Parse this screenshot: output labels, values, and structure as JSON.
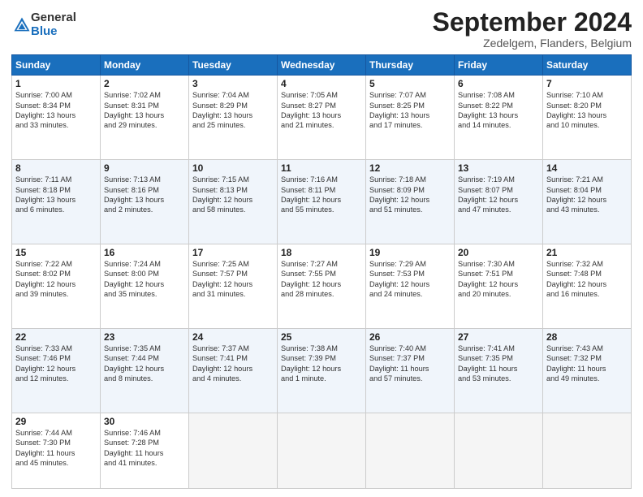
{
  "logo": {
    "general": "General",
    "blue": "Blue"
  },
  "title": "September 2024",
  "subtitle": "Zedelgem, Flanders, Belgium",
  "days": [
    "Sunday",
    "Monday",
    "Tuesday",
    "Wednesday",
    "Thursday",
    "Friday",
    "Saturday"
  ],
  "weeks": [
    [
      {
        "day": "1",
        "text": "Sunrise: 7:00 AM\nSunset: 8:34 PM\nDaylight: 13 hours\nand 33 minutes."
      },
      {
        "day": "2",
        "text": "Sunrise: 7:02 AM\nSunset: 8:31 PM\nDaylight: 13 hours\nand 29 minutes."
      },
      {
        "day": "3",
        "text": "Sunrise: 7:04 AM\nSunset: 8:29 PM\nDaylight: 13 hours\nand 25 minutes."
      },
      {
        "day": "4",
        "text": "Sunrise: 7:05 AM\nSunset: 8:27 PM\nDaylight: 13 hours\nand 21 minutes."
      },
      {
        "day": "5",
        "text": "Sunrise: 7:07 AM\nSunset: 8:25 PM\nDaylight: 13 hours\nand 17 minutes."
      },
      {
        "day": "6",
        "text": "Sunrise: 7:08 AM\nSunset: 8:22 PM\nDaylight: 13 hours\nand 14 minutes."
      },
      {
        "day": "7",
        "text": "Sunrise: 7:10 AM\nSunset: 8:20 PM\nDaylight: 13 hours\nand 10 minutes."
      }
    ],
    [
      {
        "day": "8",
        "text": "Sunrise: 7:11 AM\nSunset: 8:18 PM\nDaylight: 13 hours\nand 6 minutes."
      },
      {
        "day": "9",
        "text": "Sunrise: 7:13 AM\nSunset: 8:16 PM\nDaylight: 13 hours\nand 2 minutes."
      },
      {
        "day": "10",
        "text": "Sunrise: 7:15 AM\nSunset: 8:13 PM\nDaylight: 12 hours\nand 58 minutes."
      },
      {
        "day": "11",
        "text": "Sunrise: 7:16 AM\nSunset: 8:11 PM\nDaylight: 12 hours\nand 55 minutes."
      },
      {
        "day": "12",
        "text": "Sunrise: 7:18 AM\nSunset: 8:09 PM\nDaylight: 12 hours\nand 51 minutes."
      },
      {
        "day": "13",
        "text": "Sunrise: 7:19 AM\nSunset: 8:07 PM\nDaylight: 12 hours\nand 47 minutes."
      },
      {
        "day": "14",
        "text": "Sunrise: 7:21 AM\nSunset: 8:04 PM\nDaylight: 12 hours\nand 43 minutes."
      }
    ],
    [
      {
        "day": "15",
        "text": "Sunrise: 7:22 AM\nSunset: 8:02 PM\nDaylight: 12 hours\nand 39 minutes."
      },
      {
        "day": "16",
        "text": "Sunrise: 7:24 AM\nSunset: 8:00 PM\nDaylight: 12 hours\nand 35 minutes."
      },
      {
        "day": "17",
        "text": "Sunrise: 7:25 AM\nSunset: 7:57 PM\nDaylight: 12 hours\nand 31 minutes."
      },
      {
        "day": "18",
        "text": "Sunrise: 7:27 AM\nSunset: 7:55 PM\nDaylight: 12 hours\nand 28 minutes."
      },
      {
        "day": "19",
        "text": "Sunrise: 7:29 AM\nSunset: 7:53 PM\nDaylight: 12 hours\nand 24 minutes."
      },
      {
        "day": "20",
        "text": "Sunrise: 7:30 AM\nSunset: 7:51 PM\nDaylight: 12 hours\nand 20 minutes."
      },
      {
        "day": "21",
        "text": "Sunrise: 7:32 AM\nSunset: 7:48 PM\nDaylight: 12 hours\nand 16 minutes."
      }
    ],
    [
      {
        "day": "22",
        "text": "Sunrise: 7:33 AM\nSunset: 7:46 PM\nDaylight: 12 hours\nand 12 minutes."
      },
      {
        "day": "23",
        "text": "Sunrise: 7:35 AM\nSunset: 7:44 PM\nDaylight: 12 hours\nand 8 minutes."
      },
      {
        "day": "24",
        "text": "Sunrise: 7:37 AM\nSunset: 7:41 PM\nDaylight: 12 hours\nand 4 minutes."
      },
      {
        "day": "25",
        "text": "Sunrise: 7:38 AM\nSunset: 7:39 PM\nDaylight: 12 hours\nand 1 minute."
      },
      {
        "day": "26",
        "text": "Sunrise: 7:40 AM\nSunset: 7:37 PM\nDaylight: 11 hours\nand 57 minutes."
      },
      {
        "day": "27",
        "text": "Sunrise: 7:41 AM\nSunset: 7:35 PM\nDaylight: 11 hours\nand 53 minutes."
      },
      {
        "day": "28",
        "text": "Sunrise: 7:43 AM\nSunset: 7:32 PM\nDaylight: 11 hours\nand 49 minutes."
      }
    ],
    [
      {
        "day": "29",
        "text": "Sunrise: 7:44 AM\nSunset: 7:30 PM\nDaylight: 11 hours\nand 45 minutes."
      },
      {
        "day": "30",
        "text": "Sunrise: 7:46 AM\nSunset: 7:28 PM\nDaylight: 11 hours\nand 41 minutes."
      },
      {
        "day": "",
        "text": ""
      },
      {
        "day": "",
        "text": ""
      },
      {
        "day": "",
        "text": ""
      },
      {
        "day": "",
        "text": ""
      },
      {
        "day": "",
        "text": ""
      }
    ]
  ]
}
